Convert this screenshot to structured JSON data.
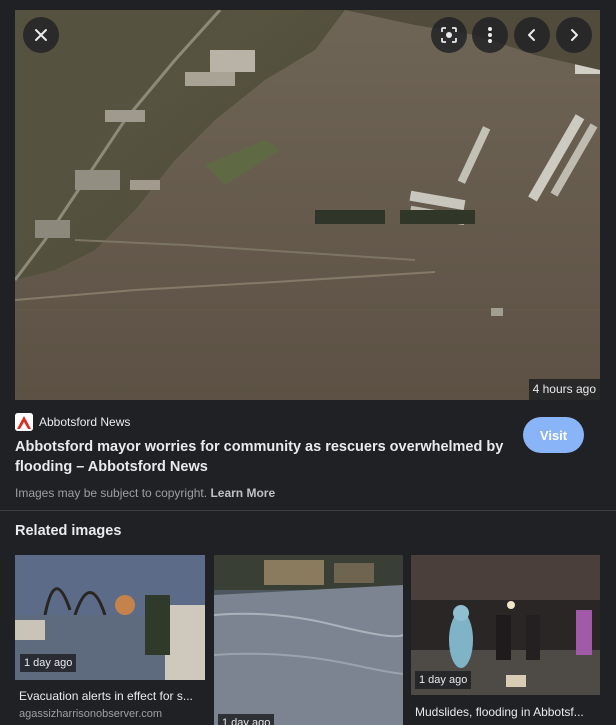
{
  "viewer": {
    "main_image": {
      "alt_icon": "aerial-flooded-farmland-image",
      "timestamp": "4 hours ago"
    },
    "controls": {
      "close_icon": "close-icon",
      "lens_icon": "lens-search-icon",
      "more_icon": "more-vertical-icon",
      "prev_icon": "chevron-left-icon",
      "next_icon": "chevron-right-icon"
    },
    "source": {
      "name": "Abbotsford News",
      "logo_icon": "abbotsford-news-logo",
      "title": "Abbotsford mayor worries for community as rescuers overwhelmed by flooding – Abbotsford News",
      "visit_label": "Visit",
      "copyright_text": "Images may be subject to copyright.",
      "learn_more": "Learn More"
    },
    "related": {
      "heading": "Related images",
      "items": [
        {
          "timestamp": "1 day ago",
          "caption": "Evacuation alerts in effect for s...",
          "domain": "agassizharrisonobserver.com"
        },
        {
          "timestamp": "1 day ago",
          "caption": "",
          "domain": ""
        },
        {
          "timestamp": "1 day ago",
          "caption": "Mudslides, flooding in Abbotsf...",
          "domain": ""
        }
      ]
    }
  },
  "colors": {
    "background": "#202124",
    "accent": "#8ab4f8",
    "text": "#e8eaed",
    "muted": "#9aa0a6"
  }
}
